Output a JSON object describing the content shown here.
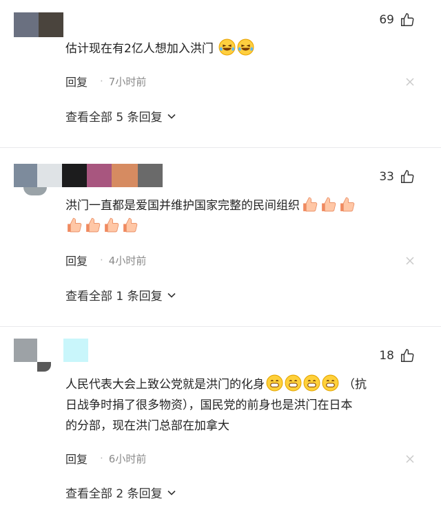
{
  "comments": [
    {
      "likes": "69",
      "text": "估计现在有2亿人想加入洪门",
      "text_lines": [
        "估计现在有2亿人想加入洪门"
      ],
      "emojis": [
        "laughing-crying-emoji",
        "laughing-crying-emoji"
      ],
      "reply_label": "回复",
      "time": "7小时前",
      "view_replies": "查看全部 5 条回复"
    },
    {
      "likes": "33",
      "text_lines": [
        "洪门一直都是爱国并维护国家完整的民间组织"
      ],
      "emojis": [
        "thumbs-up-emoji",
        "thumbs-up-emoji",
        "thumbs-up-emoji",
        "thumbs-up-emoji",
        "thumbs-up-emoji",
        "thumbs-up-emoji",
        "thumbs-up-emoji"
      ],
      "reply_label": "回复",
      "time": "4小时前",
      "view_replies": "查看全部 1 条回复"
    },
    {
      "likes": "18",
      "text_lines": [
        "人民代表大会上致公党就是洪门的化身",
        "日战争时捐了很多物资），国民党的前身也是洪门在日本",
        "的分部，现在洪门总部在加拿大"
      ],
      "inline_after_emoji": "（抗",
      "emojis": [
        "grinning-emoji",
        "grinning-emoji",
        "grinning-emoji",
        "grinning-emoji"
      ],
      "reply_label": "回复",
      "time": "6小时前",
      "view_replies": "查看全部 2 条回复"
    }
  ],
  "colors": {
    "text": "#222222",
    "muted": "#8a8a8a",
    "divider": "#e9e9ec"
  }
}
